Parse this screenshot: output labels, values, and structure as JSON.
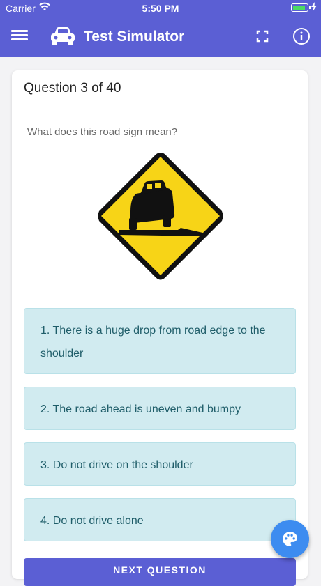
{
  "status": {
    "carrier": "Carrier",
    "time": "5:50 PM",
    "battery_level": 0.9
  },
  "app_bar": {
    "title": "Test Simulator",
    "icons": [
      "menu-icon",
      "car-icon",
      "fullscreen-icon",
      "info-icon"
    ]
  },
  "question": {
    "header": "Question 3 of 40",
    "text": "What does this road sign mean?",
    "image": "road-sign-soft-shoulder"
  },
  "options": [
    {
      "label": "1. There is a huge drop from road edge to the shoulder"
    },
    {
      "label": "2. The road ahead is uneven and bumpy"
    },
    {
      "label": "3. Do not drive on the shoulder"
    },
    {
      "label": "4. Do not drive alone"
    }
  ],
  "next_button": {
    "label": "NEXT QUESTION"
  },
  "fab": {
    "icon": "palette-icon"
  },
  "colors": {
    "primary": "#5b5fd4",
    "option_bg": "#d1ebf0",
    "option_text": "#1f5d69",
    "sign_yellow": "#f7d417",
    "fab": "#3d8cf0"
  }
}
